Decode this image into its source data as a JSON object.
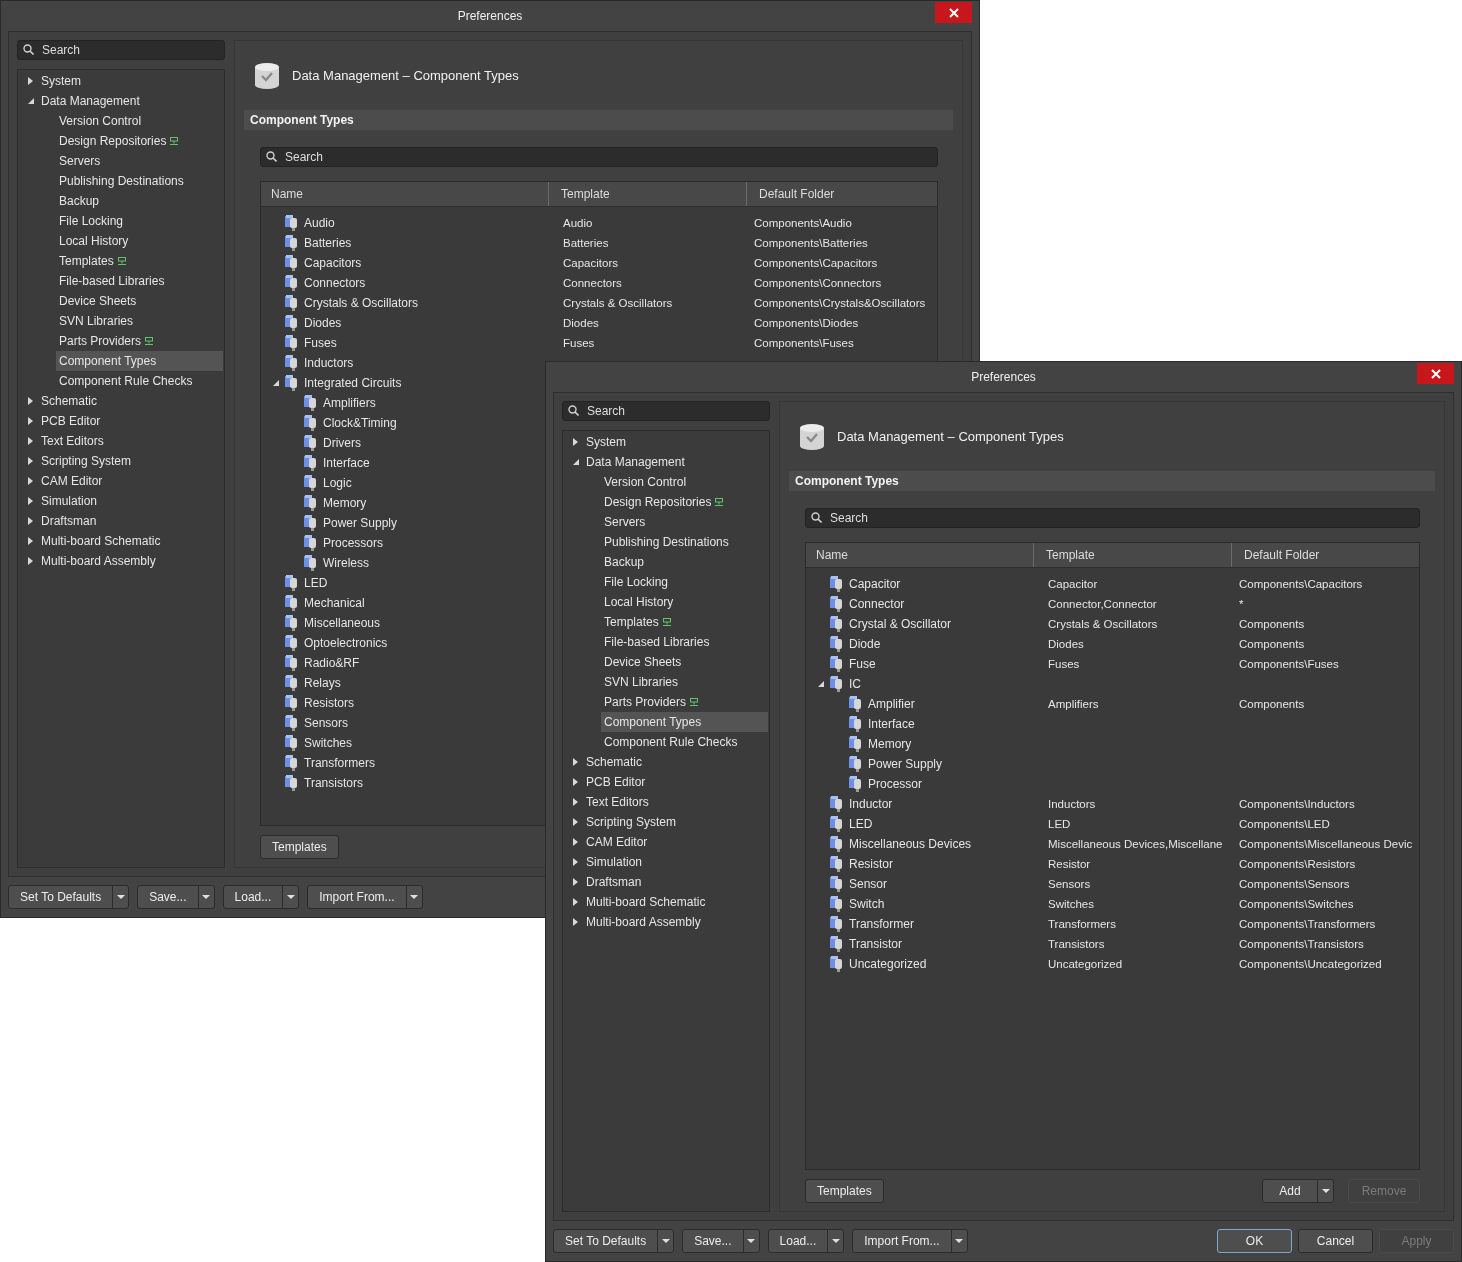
{
  "windows": [
    {
      "title": "Preferences",
      "sidebar": {
        "search": {
          "placeholder": "Search"
        },
        "tree": [
          {
            "label": "System",
            "expanded": false,
            "selected": false
          },
          {
            "label": "Data Management",
            "expanded": true,
            "selected": false,
            "children": [
              {
                "label": "Version Control",
                "selected": false
              },
              {
                "label": "Design Repositories",
                "selected": false,
                "badge": true
              },
              {
                "label": "Servers",
                "selected": false
              },
              {
                "label": "Publishing Destinations",
                "selected": false
              },
              {
                "label": "Backup",
                "selected": false
              },
              {
                "label": "File Locking",
                "selected": false
              },
              {
                "label": "Local History",
                "selected": false
              },
              {
                "label": "Templates",
                "selected": false,
                "badge": true
              },
              {
                "label": "File-based Libraries",
                "selected": false
              },
              {
                "label": "Device Sheets",
                "selected": false
              },
              {
                "label": "SVN Libraries",
                "selected": false
              },
              {
                "label": "Parts Providers",
                "selected": false,
                "badge": true
              },
              {
                "label": "Component Types",
                "selected": true
              },
              {
                "label": "Component Rule Checks",
                "selected": false
              }
            ]
          },
          {
            "label": "Schematic",
            "expanded": false,
            "selected": false
          },
          {
            "label": "PCB Editor",
            "expanded": false,
            "selected": false
          },
          {
            "label": "Text Editors",
            "expanded": false,
            "selected": false
          },
          {
            "label": "Scripting System",
            "expanded": false,
            "selected": false
          },
          {
            "label": "CAM Editor",
            "expanded": false,
            "selected": false
          },
          {
            "label": "Simulation",
            "expanded": false,
            "selected": false
          },
          {
            "label": "Draftsman",
            "expanded": false,
            "selected": false
          },
          {
            "label": "Multi-board Schematic",
            "expanded": false,
            "selected": false
          },
          {
            "label": "Multi-board Assembly",
            "expanded": false,
            "selected": false
          }
        ]
      },
      "page": {
        "title": "Data Management – Component Types",
        "section": "Component Types",
        "search": {
          "placeholder": "Search"
        },
        "columns": [
          "Name",
          "Template",
          "Default Folder"
        ],
        "rows": [
          {
            "name": "Audio",
            "template": "Audio",
            "folder": "Components\\Audio"
          },
          {
            "name": "Batteries",
            "template": "Batteries",
            "folder": "Components\\Batteries"
          },
          {
            "name": "Capacitors",
            "template": "Capacitors",
            "folder": "Components\\Capacitors"
          },
          {
            "name": "Connectors",
            "template": "Connectors",
            "folder": "Components\\Connectors"
          },
          {
            "name": "Crystals & Oscillators",
            "template": "Crystals & Oscillators",
            "folder": "Components\\Crystals&Oscillators"
          },
          {
            "name": "Diodes",
            "template": "Diodes",
            "folder": "Components\\Diodes"
          },
          {
            "name": "Fuses",
            "template": "Fuses",
            "folder": "Components\\Fuses"
          },
          {
            "name": "Inductors"
          },
          {
            "name": "Integrated Circuits",
            "expanded": true,
            "children": [
              {
                "name": "Amplifiers"
              },
              {
                "name": "Clock&Timing"
              },
              {
                "name": "Drivers"
              },
              {
                "name": "Interface"
              },
              {
                "name": "Logic"
              },
              {
                "name": "Memory"
              },
              {
                "name": "Power Supply"
              },
              {
                "name": "Processors"
              },
              {
                "name": "Wireless"
              }
            ]
          },
          {
            "name": "LED"
          },
          {
            "name": "Mechanical"
          },
          {
            "name": "Miscellaneous"
          },
          {
            "name": "Optoelectronics"
          },
          {
            "name": "Radio&RF"
          },
          {
            "name": "Relays"
          },
          {
            "name": "Resistors"
          },
          {
            "name": "Sensors"
          },
          {
            "name": "Switches"
          },
          {
            "name": "Transformers"
          },
          {
            "name": "Transistors"
          }
        ],
        "actions": {
          "left": [
            {
              "label": "Templates",
              "dropdown": false,
              "disabled": false
            }
          ]
        }
      },
      "footer": {
        "left": [
          {
            "label": "Set To Defaults",
            "dropdown": true,
            "disabled": false
          },
          {
            "label": "Save...",
            "dropdown": true,
            "disabled": false
          },
          {
            "label": "Load...",
            "dropdown": true,
            "disabled": false
          },
          {
            "label": "Import From...",
            "dropdown": true,
            "disabled": false
          }
        ]
      }
    },
    {
      "title": "Preferences",
      "sidebar": {
        "search": {
          "placeholder": "Search"
        },
        "tree": [
          {
            "label": "System",
            "expanded": false,
            "selected": false
          },
          {
            "label": "Data Management",
            "expanded": true,
            "selected": false,
            "children": [
              {
                "label": "Version Control",
                "selected": false
              },
              {
                "label": "Design Repositories",
                "selected": false,
                "badge": true
              },
              {
                "label": "Servers",
                "selected": false
              },
              {
                "label": "Publishing Destinations",
                "selected": false
              },
              {
                "label": "Backup",
                "selected": false
              },
              {
                "label": "File Locking",
                "selected": false
              },
              {
                "label": "Local History",
                "selected": false
              },
              {
                "label": "Templates",
                "selected": false,
                "badge": true
              },
              {
                "label": "File-based Libraries",
                "selected": false
              },
              {
                "label": "Device Sheets",
                "selected": false
              },
              {
                "label": "SVN Libraries",
                "selected": false
              },
              {
                "label": "Parts Providers",
                "selected": false,
                "badge": true
              },
              {
                "label": "Component Types",
                "selected": true
              },
              {
                "label": "Component Rule Checks",
                "selected": false
              }
            ]
          },
          {
            "label": "Schematic",
            "expanded": false,
            "selected": false
          },
          {
            "label": "PCB Editor",
            "expanded": false,
            "selected": false
          },
          {
            "label": "Text Editors",
            "expanded": false,
            "selected": false
          },
          {
            "label": "Scripting System",
            "expanded": false,
            "selected": false
          },
          {
            "label": "CAM Editor",
            "expanded": false,
            "selected": false
          },
          {
            "label": "Simulation",
            "expanded": false,
            "selected": false
          },
          {
            "label": "Draftsman",
            "expanded": false,
            "selected": false
          },
          {
            "label": "Multi-board Schematic",
            "expanded": false,
            "selected": false
          },
          {
            "label": "Multi-board Assembly",
            "expanded": false,
            "selected": false
          }
        ]
      },
      "page": {
        "title": "Data Management – Component Types",
        "section": "Component Types",
        "search": {
          "placeholder": "Search"
        },
        "columns": [
          "Name",
          "Template",
          "Default Folder"
        ],
        "rows": [
          {
            "name": "Capacitor",
            "template": "Capacitor",
            "folder": "Components\\Capacitors"
          },
          {
            "name": "Connector",
            "template": "Connector,Connector",
            "folder": "*"
          },
          {
            "name": "Crystal & Oscillator",
            "template": "Crystals & Oscillators",
            "folder": "Components"
          },
          {
            "name": "Diode",
            "template": "Diodes",
            "folder": "Components"
          },
          {
            "name": "Fuse",
            "template": "Fuses",
            "folder": "Components\\Fuses"
          },
          {
            "name": "IC",
            "expanded": true,
            "children": [
              {
                "name": "Amplifier",
                "template": "Amplifiers",
                "folder": "Components"
              },
              {
                "name": "Interface"
              },
              {
                "name": "Memory"
              },
              {
                "name": "Power Supply"
              },
              {
                "name": "Processor"
              }
            ]
          },
          {
            "name": "Inductor",
            "template": "Inductors",
            "folder": "Components\\Inductors"
          },
          {
            "name": "LED",
            "template": "LED",
            "folder": "Components\\LED"
          },
          {
            "name": "Miscellaneous Devices",
            "template": "Miscellaneous Devices,Miscellane",
            "folder": "Components\\Miscellaneous Devic"
          },
          {
            "name": "Resistor",
            "template": "Resistor",
            "folder": "Components\\Resistors"
          },
          {
            "name": "Sensor",
            "template": "Sensors",
            "folder": "Components\\Sensors"
          },
          {
            "name": "Switch",
            "template": "Switches",
            "folder": "Components\\Switches"
          },
          {
            "name": "Transformer",
            "template": "Transformers",
            "folder": "Components\\Transformers"
          },
          {
            "name": "Transistor",
            "template": "Transistors",
            "folder": "Components\\Transistors"
          },
          {
            "name": "Uncategorized",
            "template": "Uncategorized",
            "folder": "Components\\Uncategorized"
          }
        ],
        "actions": {
          "left": [
            {
              "label": "Templates",
              "dropdown": false,
              "disabled": false
            }
          ],
          "right": [
            {
              "label": "Add",
              "dropdown": true,
              "disabled": false
            },
            {
              "label": "Remove",
              "dropdown": false,
              "disabled": true
            }
          ]
        }
      },
      "footer": {
        "left": [
          {
            "label": "Set To Defaults",
            "dropdown": true,
            "disabled": false
          },
          {
            "label": "Save...",
            "dropdown": true,
            "disabled": false
          },
          {
            "label": "Load...",
            "dropdown": true,
            "disabled": false
          },
          {
            "label": "Import From...",
            "dropdown": true,
            "disabled": false
          }
        ],
        "right": [
          {
            "label": "OK",
            "dropdown": false,
            "default": true,
            "disabled": false
          },
          {
            "label": "Cancel",
            "dropdown": false,
            "default": false,
            "disabled": false
          },
          {
            "label": "Apply",
            "dropdown": false,
            "default": false,
            "disabled": true
          }
        ]
      }
    }
  ]
}
